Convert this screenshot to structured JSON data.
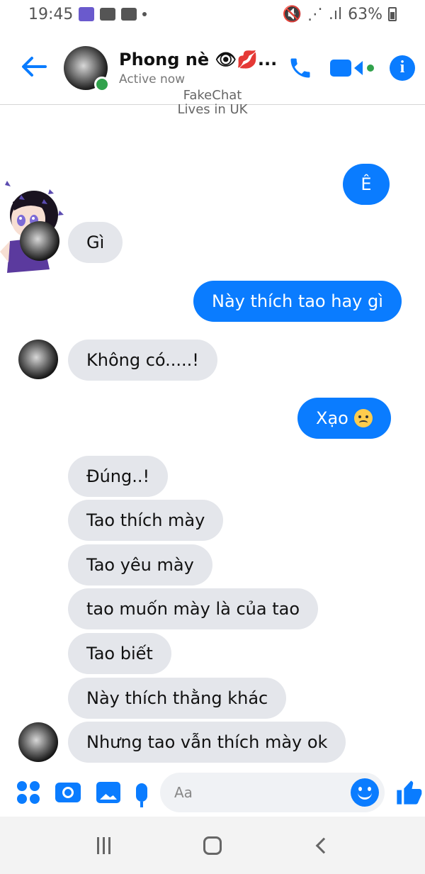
{
  "status_bar": {
    "time": "19:45",
    "battery": "63%"
  },
  "header": {
    "name": "Phong nè 👁💋...",
    "status": "Active now"
  },
  "watermark": {
    "line1": "FakeChat",
    "line2": "Lives in UK"
  },
  "messages": [
    {
      "side": "out",
      "text": "Ê"
    },
    {
      "side": "in",
      "text": "Gì"
    },
    {
      "side": "out",
      "text": "Này thích tao hay gì"
    },
    {
      "side": "in",
      "text": "Không có.....!"
    },
    {
      "side": "out",
      "text": "Xạo",
      "emoji": "angry-face-icon"
    },
    {
      "side": "in",
      "text": "Đúng..!"
    },
    {
      "side": "in",
      "text": "Tao thích mày"
    },
    {
      "side": "in",
      "text": "Tao yêu mày"
    },
    {
      "side": "in",
      "text": "tao muốn mày là của tao"
    },
    {
      "side": "in",
      "text": "Tao biết"
    },
    {
      "side": "in",
      "text": "Này thích thằng khác"
    },
    {
      "side": "in",
      "text": "Nhưng tao vẫn thích mày ok"
    }
  ],
  "composer": {
    "placeholder": "Aa"
  },
  "colors": {
    "accent": "#0a7cff",
    "incoming_bubble": "#e4e6eb",
    "online": "#31a24c"
  },
  "icons": [
    "back-arrow-icon",
    "phone-icon",
    "video-call-icon",
    "info-icon",
    "apps-grid-icon",
    "camera-icon",
    "gallery-icon",
    "microphone-icon",
    "emoji-icon",
    "like-icon"
  ]
}
